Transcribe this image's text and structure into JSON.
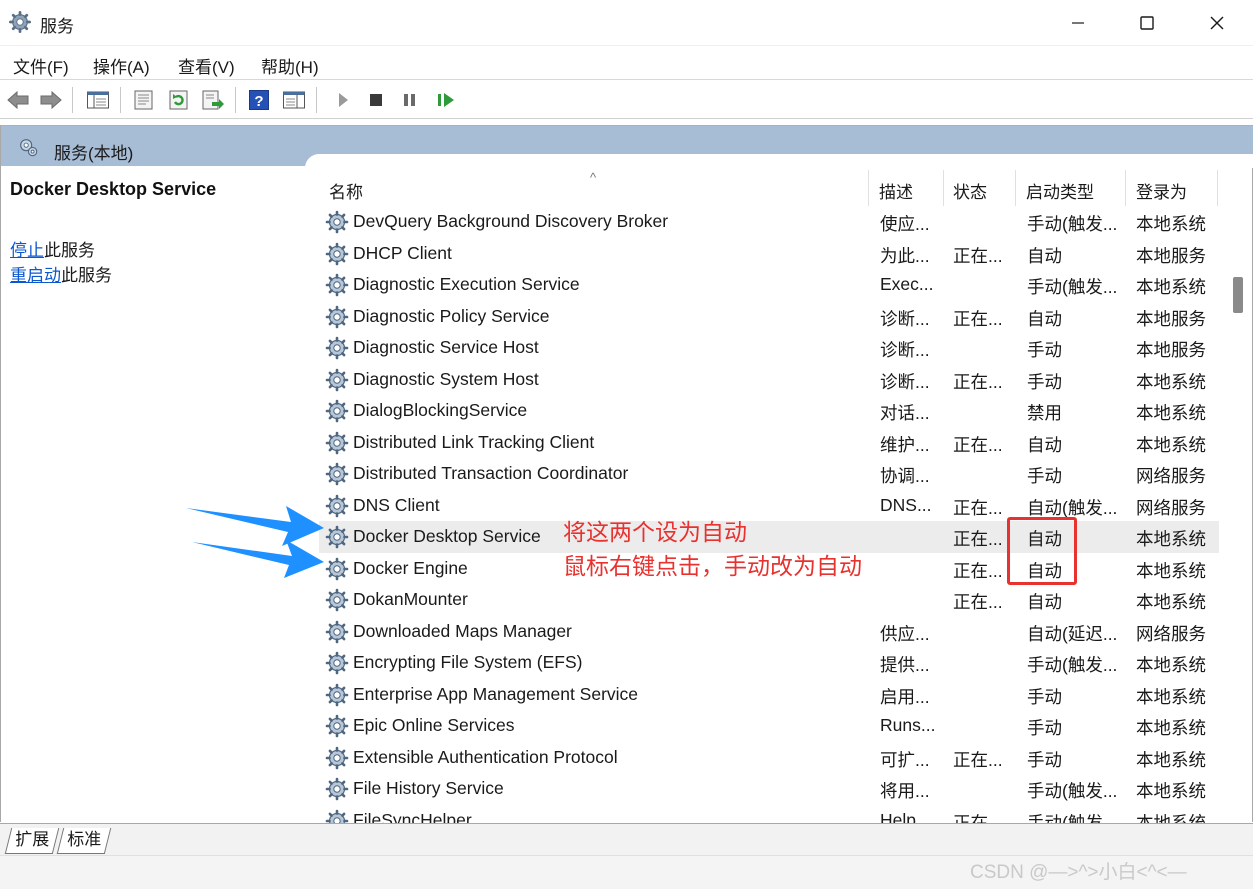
{
  "window": {
    "title": "服务",
    "icon": "gear-icon",
    "controls": [
      "minimize-icon",
      "maximize-icon",
      "close-icon"
    ]
  },
  "menu": [
    {
      "label": "文件(F)"
    },
    {
      "label": "操作(A)"
    },
    {
      "label": "查看(V)"
    },
    {
      "label": "帮助(H)"
    }
  ],
  "toolbar": {
    "buttons": [
      "back-icon",
      "forward-icon",
      "console-tree-icon",
      "properties-icon",
      "refresh-icon",
      "export-list-icon",
      "help-icon",
      "view-icon",
      "start-icon",
      "stop-icon",
      "pause-icon",
      "restart-icon"
    ]
  },
  "scope": {
    "title": "服务(本地)"
  },
  "detail": {
    "heading": "Docker Desktop Service",
    "actions": [
      {
        "link": "停止",
        "suffix": "此服务"
      },
      {
        "link": "重启动",
        "suffix": "此服务"
      }
    ]
  },
  "columns": {
    "name": "名称",
    "desc": "描述",
    "status": "状态",
    "startup": "启动类型",
    "logon": "登录为"
  },
  "services": [
    {
      "name": "DevQuery Background Discovery Broker",
      "desc": "使应...",
      "status": "",
      "startup": "手动(触发...",
      "logon": "本地系统"
    },
    {
      "name": "DHCP Client",
      "desc": "为此...",
      "status": "正在...",
      "startup": "自动",
      "logon": "本地服务"
    },
    {
      "name": "Diagnostic Execution Service",
      "desc": "Exec...",
      "status": "",
      "startup": "手动(触发...",
      "logon": "本地系统"
    },
    {
      "name": "Diagnostic Policy Service",
      "desc": "诊断...",
      "status": "正在...",
      "startup": "自动",
      "logon": "本地服务"
    },
    {
      "name": "Diagnostic Service Host",
      "desc": "诊断...",
      "status": "",
      "startup": "手动",
      "logon": "本地服务"
    },
    {
      "name": "Diagnostic System Host",
      "desc": "诊断...",
      "status": "正在...",
      "startup": "手动",
      "logon": "本地系统"
    },
    {
      "name": "DialogBlockingService",
      "desc": "对话...",
      "status": "",
      "startup": "禁用",
      "logon": "本地系统"
    },
    {
      "name": "Distributed Link Tracking Client",
      "desc": "维护...",
      "status": "正在...",
      "startup": "自动",
      "logon": "本地系统"
    },
    {
      "name": "Distributed Transaction Coordinator",
      "desc": "协调...",
      "status": "",
      "startup": "手动",
      "logon": "网络服务"
    },
    {
      "name": "DNS Client",
      "desc": "DNS...",
      "status": "正在...",
      "startup": "自动(触发...",
      "logon": "网络服务"
    },
    {
      "name": "Docker Desktop Service",
      "desc": "",
      "status": "正在...",
      "startup": "自动",
      "logon": "本地系统",
      "selected": true
    },
    {
      "name": "Docker Engine",
      "desc": "",
      "status": "正在...",
      "startup": "自动",
      "logon": "本地系统"
    },
    {
      "name": "DokanMounter",
      "desc": "",
      "status": "正在...",
      "startup": "自动",
      "logon": "本地系统"
    },
    {
      "name": "Downloaded Maps Manager",
      "desc": "供应...",
      "status": "",
      "startup": "自动(延迟...",
      "logon": "网络服务"
    },
    {
      "name": "Encrypting File System (EFS)",
      "desc": "提供...",
      "status": "",
      "startup": "手动(触发...",
      "logon": "本地系统"
    },
    {
      "name": "Enterprise App Management Service",
      "desc": "启用...",
      "status": "",
      "startup": "手动",
      "logon": "本地系统"
    },
    {
      "name": "Epic Online Services",
      "desc": "Runs...",
      "status": "",
      "startup": "手动",
      "logon": "本地系统"
    },
    {
      "name": "Extensible Authentication Protocol",
      "desc": "可扩...",
      "status": "正在...",
      "startup": "手动",
      "logon": "本地系统"
    },
    {
      "name": "File History Service",
      "desc": "将用...",
      "status": "",
      "startup": "手动(触发...",
      "logon": "本地系统"
    },
    {
      "name": "FileSyncHelper",
      "desc": "Help...",
      "status": "正在...",
      "startup": "手动(触发...",
      "logon": "本地系统"
    }
  ],
  "tabs": [
    {
      "label": "扩展"
    },
    {
      "label": "标准"
    }
  ],
  "annotation": {
    "line1": "将这两个设为自动",
    "line2": "鼠标右键点击，手动改为自动",
    "color": "#e8322f",
    "arrow_color": "#1e90ff"
  },
  "watermark": "CSDN @—>^>小白<^<—"
}
